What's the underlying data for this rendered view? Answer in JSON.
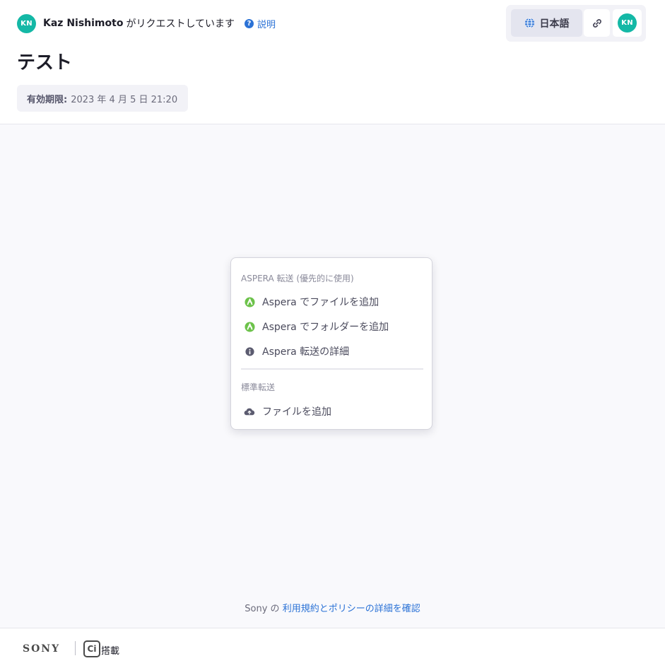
{
  "header": {
    "requester_initials": "KN",
    "requester_name": "Kaz Nishimoto",
    "request_text": "がリクエストしています",
    "help_label": "説明",
    "language_label": "日本語",
    "account_initials": "KN",
    "page_title": "テスト",
    "expiry_label": "有効期限:",
    "expiry_value": "2023 年 4 月 5 日 21:20"
  },
  "menu": {
    "aspera_section": "ASPERA 転送 (優先的に使用)",
    "aspera_items": [
      {
        "label": "Aspera でファイルを追加",
        "icon": "aspera-icon"
      },
      {
        "label": "Aspera でフォルダーを追加",
        "icon": "aspera-icon"
      },
      {
        "label": "Aspera 転送の詳細",
        "icon": "info-icon"
      }
    ],
    "standard_section": "標準転送",
    "standard_items": [
      {
        "label": "ファイルを追加",
        "icon": "cloud-upload-icon"
      }
    ]
  },
  "terms": {
    "prefix": "Sony の",
    "link": "利用規約とポリシーの詳細を確認"
  },
  "footer": {
    "brand": "SONY",
    "product_mark": "Ci",
    "powered_label": "搭載"
  },
  "colors": {
    "accent_teal": "#14b8a6",
    "link_blue": "#2b72d6",
    "aspera_green": "#6cc24a"
  }
}
